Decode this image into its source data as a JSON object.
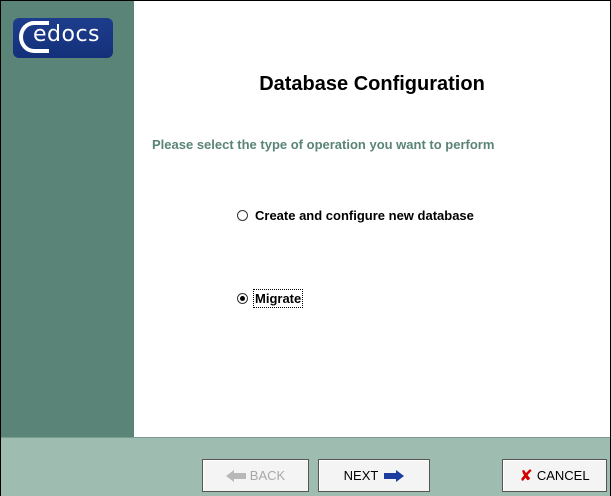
{
  "logo": {
    "text": "edocs"
  },
  "title": "Database Configuration",
  "instruction": "Please select the type of operation you want to perform",
  "options": [
    {
      "label": "Create and configure new database",
      "selected": false
    },
    {
      "label": "Migrate",
      "selected": true
    }
  ],
  "buttons": {
    "back": {
      "label": "BACK",
      "enabled": false,
      "icon": "arrow-left-icon"
    },
    "next": {
      "label": "NEXT",
      "enabled": true,
      "icon": "arrow-right-icon"
    },
    "cancel": {
      "label": "CANCEL",
      "enabled": true,
      "icon": "x-icon"
    }
  },
  "colors": {
    "sidebar": "#5a8478",
    "bottombar": "#9fbcb1",
    "instruction": "#5a8478",
    "logo_bg": "#14307a"
  }
}
